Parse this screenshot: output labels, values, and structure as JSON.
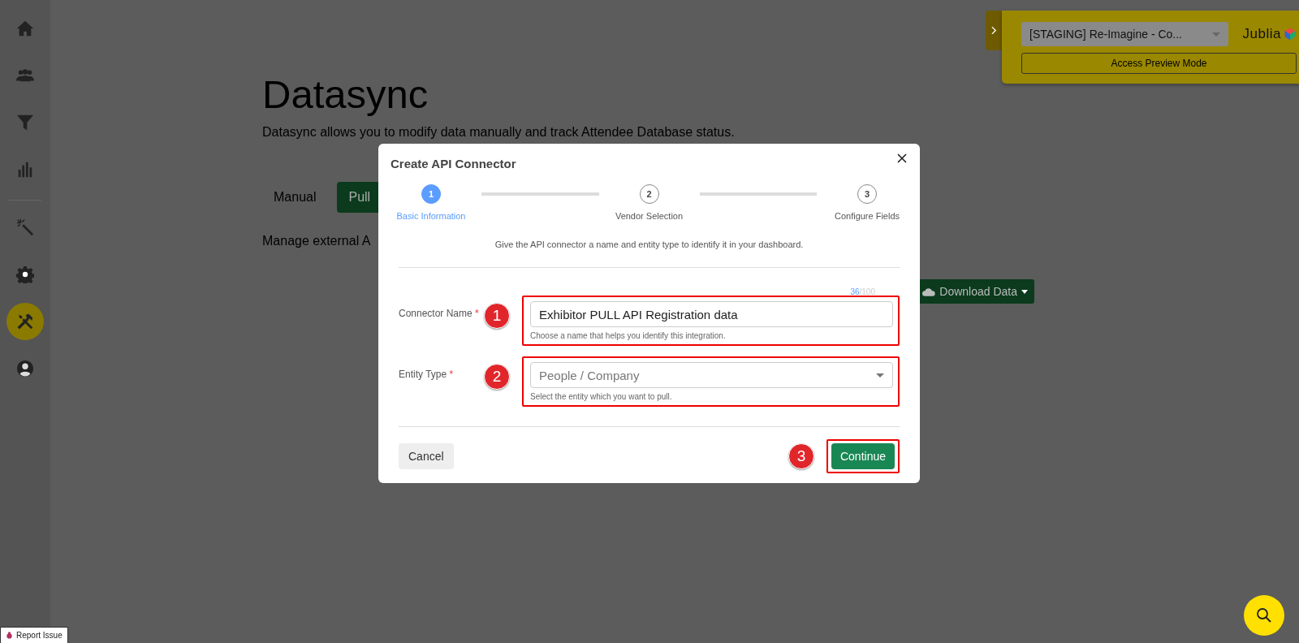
{
  "sidebar": {
    "groups": [
      {
        "items": [
          {
            "kind": "home",
            "selected": false
          },
          {
            "kind": "people",
            "selected": false
          },
          {
            "kind": "filter",
            "selected": false
          },
          {
            "kind": "chart",
            "selected": false
          }
        ]
      },
      {
        "items": [
          {
            "kind": "wand",
            "selected": false
          },
          {
            "kind": "gear",
            "selected": false
          },
          {
            "kind": "tools",
            "selected": true
          },
          {
            "kind": "user",
            "selected": false
          }
        ]
      }
    ]
  },
  "page": {
    "title": "Datasync",
    "subtitle": "Datasync allows you to modify data manually and track Attendee Database status.",
    "tabs": [
      {
        "label": "Manual",
        "selected": false
      },
      {
        "label": "Pull",
        "selected": true
      }
    ],
    "description": "Manage external A",
    "download_button": "Download Data"
  },
  "preview_panel": {
    "event_select": "[STAGING] Re-Imagine - Co...",
    "logo": "Jublia",
    "button": "Access Preview Mode"
  },
  "modal": {
    "title": "Create API Connector",
    "steps": [
      {
        "number": "1",
        "label": "Basic Information",
        "selected": true
      },
      {
        "number": "2",
        "label": "Vendor Selection",
        "selected": false
      },
      {
        "number": "3",
        "label": "Configure Fields",
        "selected": false
      }
    ],
    "description": "Give the API connector a name and entity type to identify it in your dashboard.",
    "fields": [
      {
        "kind": "text",
        "label": "Connector Name",
        "required_mark": "*",
        "counter": "36",
        "limit": "/100",
        "value": "Exhibitor PULL API Registration data",
        "help": "Choose a name that helps you identify this integration.",
        "annotation": "1"
      },
      {
        "kind": "select",
        "label": "Entity Type",
        "required_mark": "*",
        "placeholder": "People / Company",
        "help": "Select the entity which you want to pull.",
        "annotation": "2"
      }
    ],
    "cancel_button": "Cancel",
    "continue_button": "Continue",
    "continue_annotation": "3"
  },
  "report_issue": "Report Issue"
}
